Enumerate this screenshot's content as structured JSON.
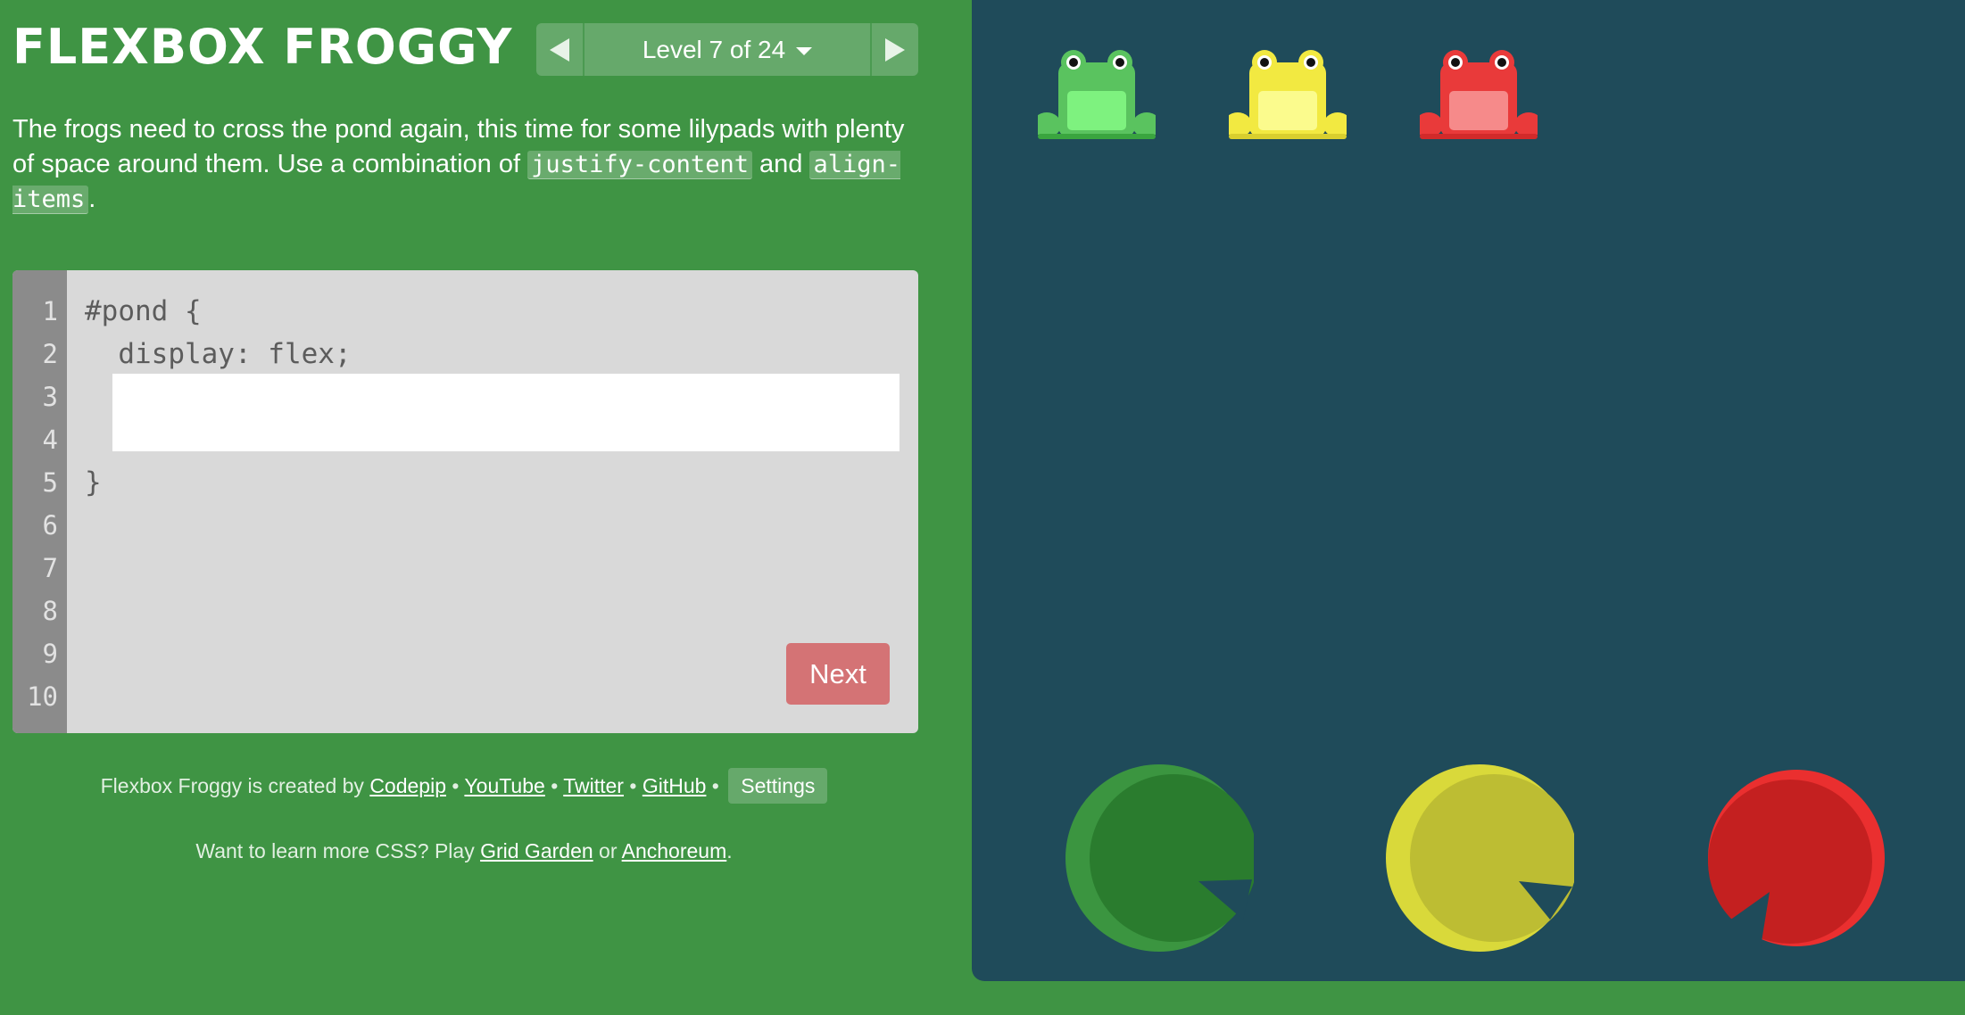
{
  "app": {
    "title": "FLEXBOX FROGGY"
  },
  "level_nav": {
    "label": "Level 7 of 24",
    "prev_icon": "triangle-left-icon",
    "next_icon": "triangle-right-icon",
    "dropdown_icon": "caret-down-icon"
  },
  "instructions": {
    "part1": "The frogs need to cross the pond again, this time for some lilypads with plenty of space around them. Use a combination of ",
    "code1": "justify-content",
    "part2": " and ",
    "code2": "align-items",
    "part3": "."
  },
  "editor": {
    "line_numbers": [
      "1",
      "2",
      "3",
      "4",
      "5",
      "6",
      "7",
      "8",
      "9",
      "10"
    ],
    "line1": "#pond {",
    "line2": "  display: flex;",
    "line5": "}",
    "input_value": "",
    "next_label": "Next"
  },
  "credits": {
    "prefix": "Flexbox Froggy is created by ",
    "codepip": "Codepip",
    "youtube": "YouTube",
    "twitter": "Twitter",
    "github": "GitHub",
    "sep": " • ",
    "settings": "Settings"
  },
  "learn_more": {
    "prefix": "Want to learn more CSS? Play ",
    "grid_garden": "Grid Garden",
    "or": " or ",
    "anchoreum": "Anchoreum",
    "suffix": "."
  },
  "pond": {
    "frogs": [
      {
        "color": "green",
        "body": "#5ac35f",
        "belly": "#7ef27f"
      },
      {
        "color": "yellow",
        "body": "#f2e941",
        "belly": "#fbfb8d"
      },
      {
        "color": "red",
        "body": "#e93a3a",
        "belly": "#f68a8a"
      }
    ],
    "lilypads": [
      {
        "color": "green",
        "fill": "#2a7c2e",
        "rim": "#3b9540"
      },
      {
        "color": "yellow",
        "fill": "#bdbd33",
        "rim": "#d9d93a"
      },
      {
        "color": "red",
        "fill": "#c42020",
        "rim": "#ea2f2f"
      }
    ],
    "background": "#1f4b5a"
  },
  "colors": {
    "page_bg": "#3f9444",
    "next_button": "#d47375",
    "nav_bg": "#66a96b"
  }
}
